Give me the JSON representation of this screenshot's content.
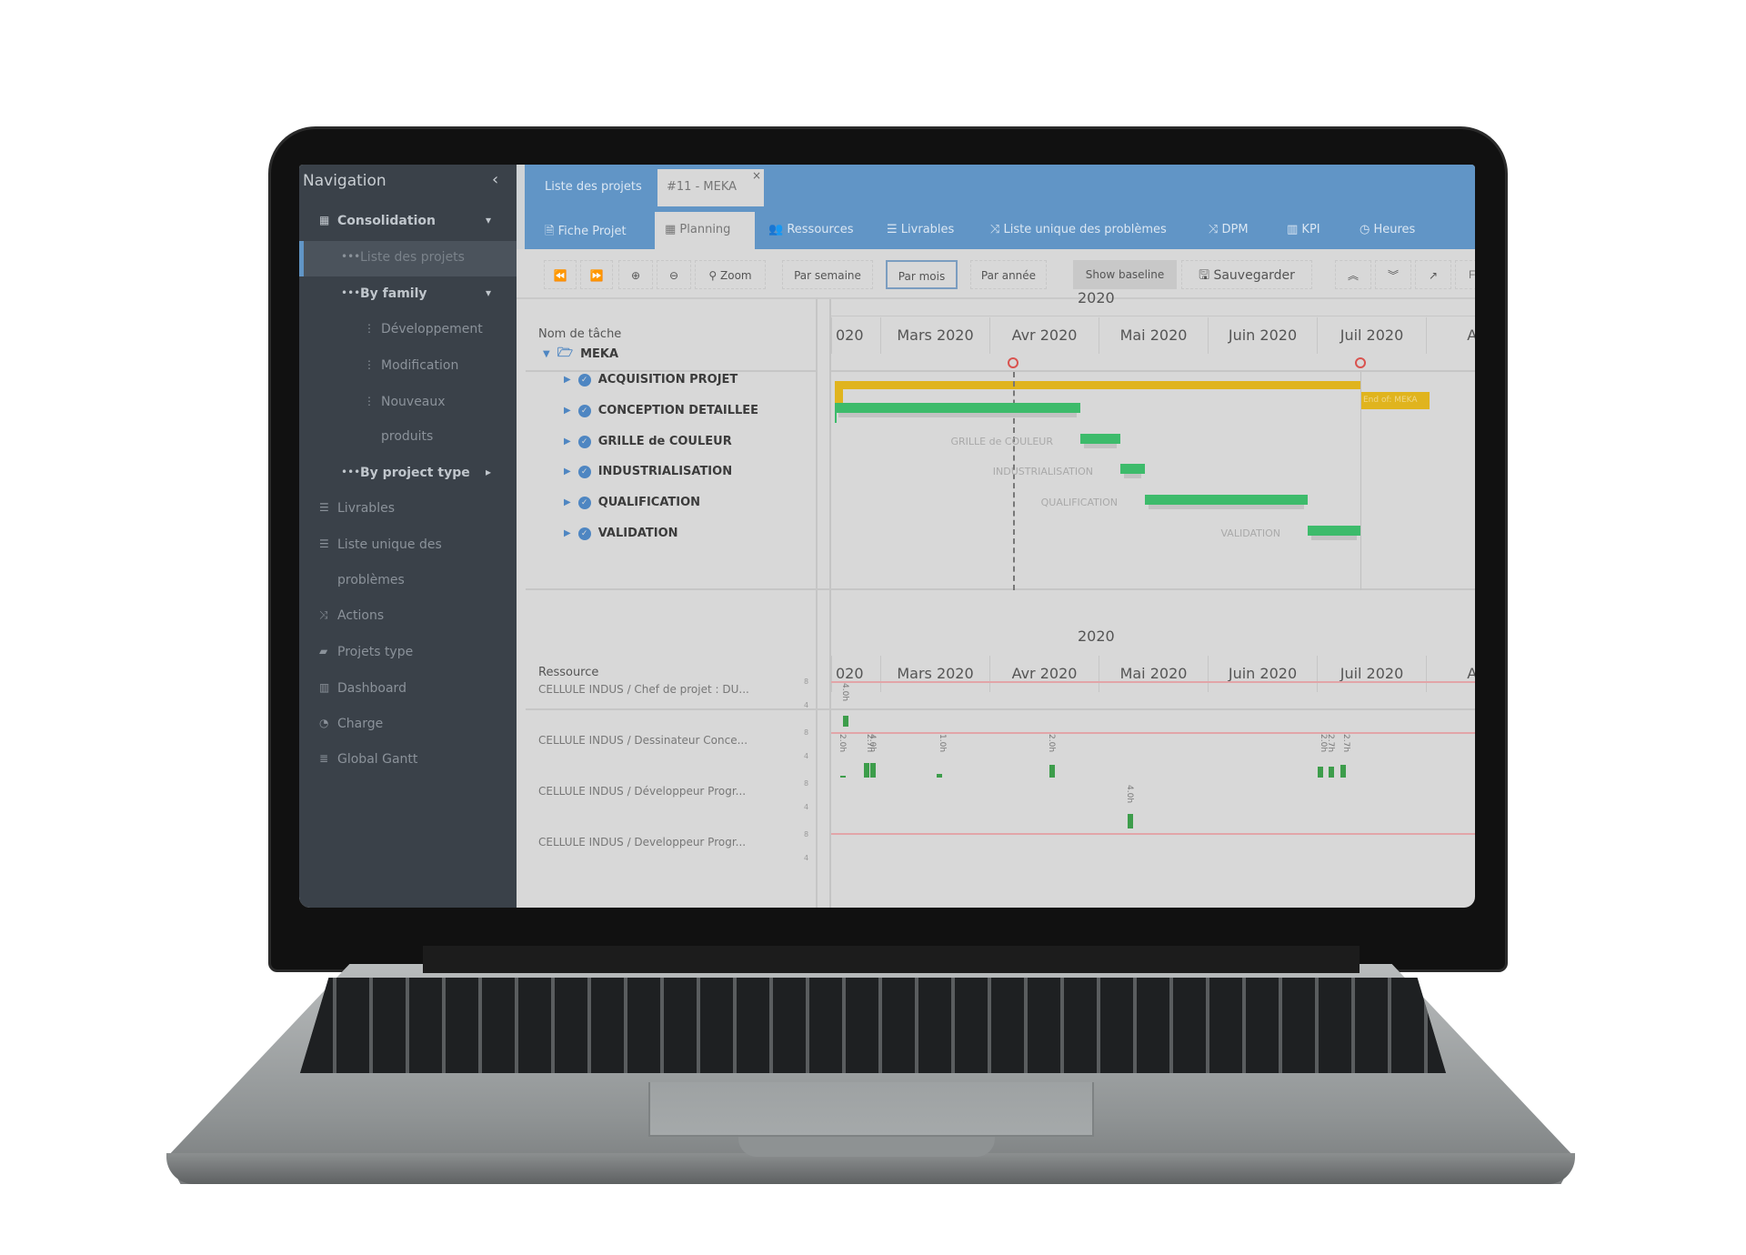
{
  "sidebar": {
    "title": "Navigation",
    "items": [
      {
        "label": "Consolidation",
        "icon": "calendar-icon",
        "level": 0,
        "bold": true,
        "arrow": "▾"
      },
      {
        "label": "Liste des projets",
        "icon": "ellipsis-icon",
        "level": 1,
        "selected": true
      },
      {
        "label": "By family",
        "icon": "ellipsis-icon",
        "level": 1,
        "bold": true,
        "arrow": "▾"
      },
      {
        "label": "Développement",
        "icon": "vertical-ellipsis-icon",
        "level": 2
      },
      {
        "label": "Modification",
        "icon": "vertical-ellipsis-icon",
        "level": 2
      },
      {
        "label": "Nouveaux",
        "icon": "vertical-ellipsis-icon",
        "level": 2
      },
      {
        "label": "produits",
        "icon": "",
        "level": 2
      },
      {
        "label": "By project type",
        "icon": "ellipsis-icon",
        "level": 1,
        "bold": true,
        "arrow": "▸"
      },
      {
        "label": "Livrables",
        "icon": "list-icon",
        "level": 0
      },
      {
        "label": "Liste unique des",
        "icon": "list-icon",
        "level": 0
      },
      {
        "label": "problèmes",
        "icon": "",
        "level": 0
      },
      {
        "label": "Actions",
        "icon": "shuffle-icon",
        "level": 0
      },
      {
        "label": "Projets type",
        "icon": "book-icon",
        "level": 0
      },
      {
        "label": "Dashboard",
        "icon": "bar-chart-icon",
        "level": 0
      },
      {
        "label": "Charge",
        "icon": "gauge-icon",
        "level": 0
      },
      {
        "label": "Global Gantt",
        "icon": "gantt-icon",
        "level": 0
      }
    ]
  },
  "top_tabs": [
    {
      "label": "Liste des projets"
    },
    {
      "label": "#11 - MEKA",
      "active": true,
      "closable": true
    }
  ],
  "module_tabs": [
    {
      "label": "Fiche Projet",
      "icon": "document-icon"
    },
    {
      "label": "Planning",
      "icon": "calendar-icon",
      "active": true
    },
    {
      "label": "Ressources",
      "icon": "users-icon"
    },
    {
      "label": "Livrables",
      "icon": "list-icon"
    },
    {
      "label": "Liste unique des problèmes",
      "icon": "shuffle-icon"
    },
    {
      "label": "DPM",
      "icon": "shuffle-icon"
    },
    {
      "label": "KPI",
      "icon": "bar-chart-icon"
    },
    {
      "label": "Heures",
      "icon": "clock-icon"
    }
  ],
  "toolbar": {
    "zoom_label": "Zoom",
    "week_label": "Par semaine",
    "month_label": "Par mois",
    "year_label": "Par année",
    "baseline_label": "Show baseline",
    "save_label": "Sauvegarder",
    "filter_placeholder": "Fi"
  },
  "gantt": {
    "task_header": "Nom de tâche",
    "year": "2020",
    "months": [
      "020",
      "Mars 2020",
      "Avr 2020",
      "Mai 2020",
      "Juin 2020",
      "Juil 2020",
      "Aoû"
    ],
    "project": "MEKA",
    "end_label": "End of: MEKA",
    "tasks": [
      {
        "name": "ACQUISITION PROJET",
        "label": ""
      },
      {
        "name": "CONCEPTION DETAILLEE",
        "label": ""
      },
      {
        "name": "GRILLE de COULEUR",
        "label": "GRILLE de COULEUR"
      },
      {
        "name": "INDUSTRIALISATION",
        "label": "INDUSTRIALISATION"
      },
      {
        "name": "QUALIFICATION",
        "label": "QUALIFICATION"
      },
      {
        "name": "VALIDATION",
        "label": "VALIDATION"
      }
    ],
    "colors": {
      "project": "#e0b41e",
      "task": "#3dbb6b",
      "today": "#d9534f"
    }
  },
  "resources": {
    "header": "Ressource",
    "year": "2020",
    "months": [
      "020",
      "Mars 2020",
      "Avr 2020",
      "Mai 2020",
      "Juin 2020",
      "Juil 2020",
      "Aoû"
    ],
    "axis_ticks": [
      "8",
      "4"
    ],
    "rows": [
      {
        "name": "CELLULE INDUS / Chef de projet : DU...",
        "loads": [
          "4.0h"
        ]
      },
      {
        "name": "CELLULE INDUS / Dessinateur Conce...",
        "loads": [
          "2.0h",
          "2.7h",
          "4.0h",
          "1.0h",
          "2.0h",
          "2.0h",
          "2.7h",
          "2.7h"
        ]
      },
      {
        "name": "CELLULE INDUS / Développeur Progr...",
        "loads": [
          "4.0h"
        ]
      },
      {
        "name": "CELLULE INDUS / Developpeur Progr...",
        "loads": []
      }
    ]
  }
}
